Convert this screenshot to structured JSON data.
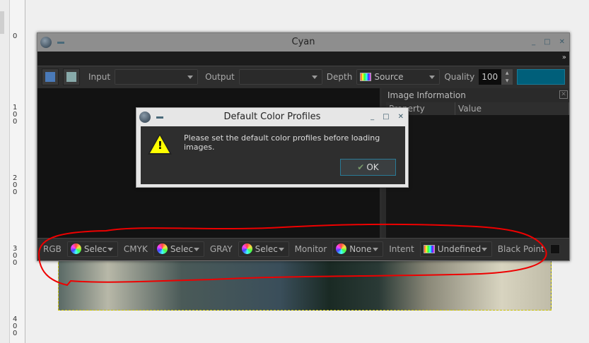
{
  "ruler": {
    "labels": [
      "0",
      "100",
      "200",
      "300",
      "400"
    ]
  },
  "window": {
    "title": "Cyan",
    "more": "»"
  },
  "toolbar": {
    "input_label": "Input",
    "input_value": "",
    "output_label": "Output",
    "output_value": "",
    "depth_label": "Depth",
    "depth_value": "Source",
    "quality_label": "Quality",
    "quality_value": "100",
    "accent": "#005f7a"
  },
  "panel": {
    "title": "Image Information",
    "columns": [
      "Property",
      "Value"
    ]
  },
  "bottombar": {
    "rgb_label": "RGB",
    "rgb_value": "Selec",
    "cmyk_label": "CMYK",
    "cmyk_value": "Selec",
    "gray_label": "GRAY",
    "gray_value": "Selec",
    "monitor_label": "Monitor",
    "monitor_value": "None",
    "intent_label": "Intent",
    "intent_value": "Undefined",
    "blackpoint_label": "Black Point"
  },
  "dialog": {
    "title": "Default Color Profiles",
    "message": "Please set the default color profiles before loading images.",
    "ok_label": "OK"
  }
}
